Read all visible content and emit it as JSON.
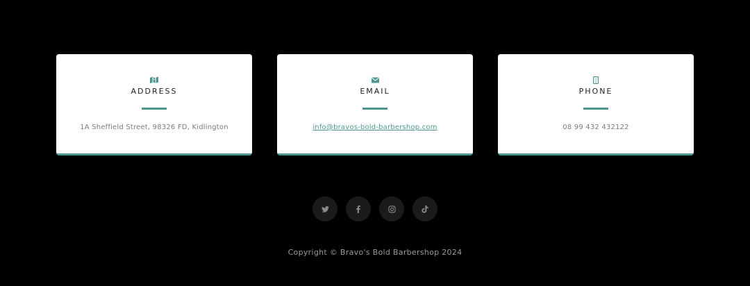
{
  "colors": {
    "accent": "#4e9690",
    "background": "#000000",
    "card": "#ffffff",
    "social_bg": "#1b1b1b",
    "social_icon": "#8a8a8a"
  },
  "contact_cards": [
    {
      "icon": "map-icon",
      "title": "ADDRESS",
      "value": "1A Sheffield Street, 98326 FD, Kidlington"
    },
    {
      "icon": "envelope-icon",
      "title": "EMAIL",
      "value": "info@bravos-bold-barbershop.com"
    },
    {
      "icon": "mobile-phone-icon",
      "title": "PHONE",
      "value": "08 99 432 432122"
    }
  ],
  "social_links": [
    {
      "icon": "twitter-icon"
    },
    {
      "icon": "facebook-icon"
    },
    {
      "icon": "instagram-icon"
    },
    {
      "icon": "tiktok-icon"
    }
  ],
  "footer": {
    "copyright": "Copyright © Bravo's Bold Barbershop 2024"
  }
}
